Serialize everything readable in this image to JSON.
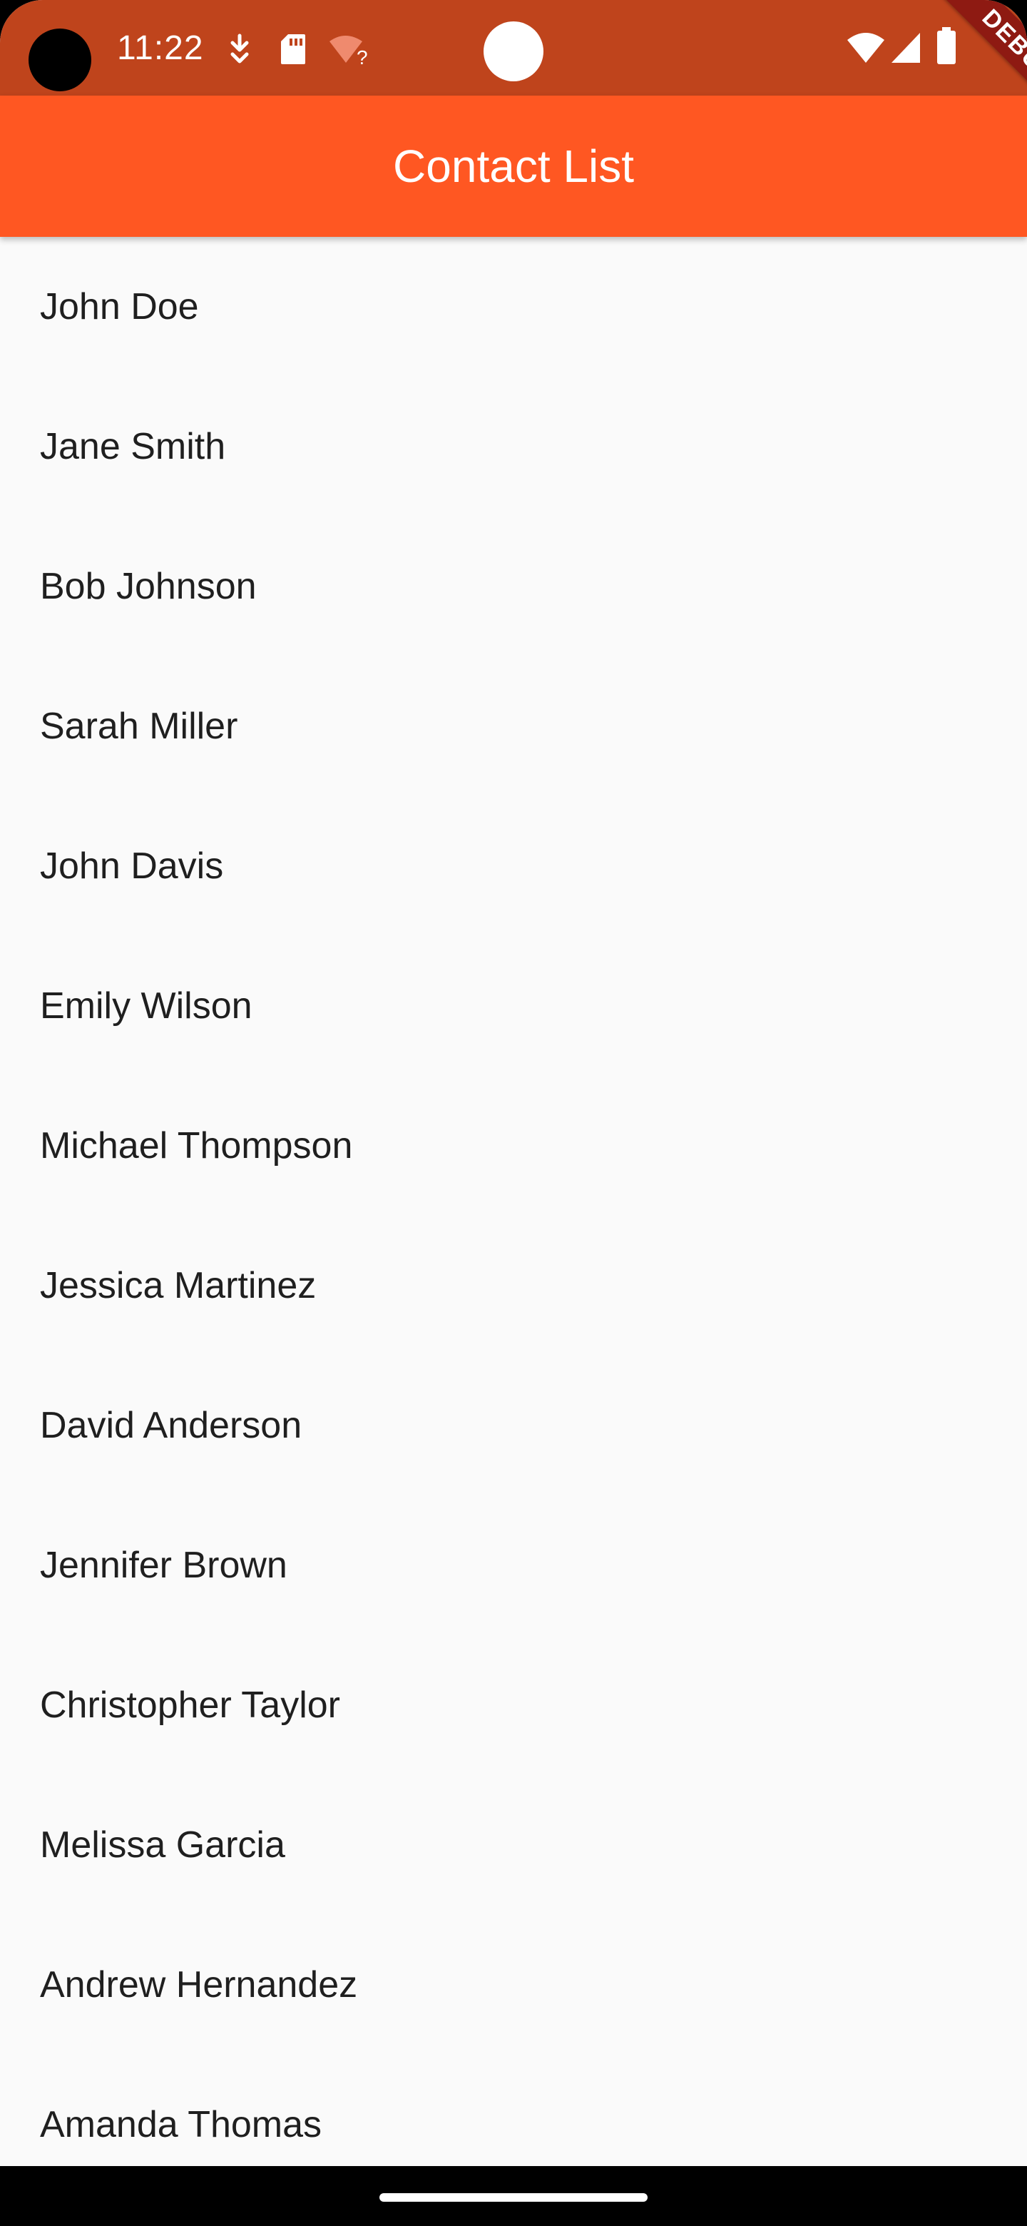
{
  "status_bar": {
    "time": "11:22",
    "icons": [
      "download-icon",
      "sd-card-icon",
      "wifi-unknown-icon",
      "wifi-icon",
      "signal-icon",
      "battery-icon"
    ]
  },
  "debug_banner": "DEBUG",
  "app_bar": {
    "title": "Contact List",
    "color": "#ff5722"
  },
  "contacts": [
    "John Doe",
    "Jane Smith",
    "Bob Johnson",
    "Sarah Miller",
    "John Davis",
    "Emily Wilson",
    "Michael Thompson",
    "Jessica Martinez",
    "David Anderson",
    "Jennifer Brown",
    "Christopher Taylor",
    "Melissa Garcia",
    "Andrew Hernandez",
    "Amanda Thomas"
  ]
}
